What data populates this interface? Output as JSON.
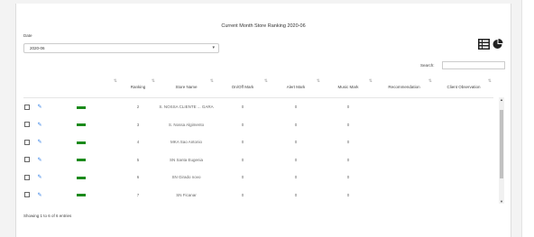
{
  "title": "Current Month Store Ranking 2020-06",
  "period": {
    "label": "Date",
    "value": "2020-06"
  },
  "search": {
    "label": "Search:",
    "value": ""
  },
  "columns": [
    "",
    "",
    "Ranking",
    "Store Name",
    "On/Off Mark",
    "Alert Mark",
    "Music Mark",
    "Recommendation",
    "Client Observation"
  ],
  "rows": [
    {
      "ranking": "2",
      "store": "S. NOSSA CLIENTE ... GARA",
      "onoff": "0",
      "alert": "0",
      "music": "0"
    },
    {
      "ranking": "3",
      "store": "S. Nossa Algimento",
      "onoff": "0",
      "alert": "0",
      "music": "0"
    },
    {
      "ranking": "4",
      "store": "MKA Sao Antonio",
      "onoff": "0",
      "alert": "0",
      "music": "0"
    },
    {
      "ranking": "5",
      "store": "SN Santa Eugenia",
      "onoff": "0",
      "alert": "0",
      "music": "0"
    },
    {
      "ranking": "6",
      "store": "SN Girado novo",
      "onoff": "0",
      "alert": "0",
      "music": "0"
    },
    {
      "ranking": "7",
      "store": "SN Ficanar",
      "onoff": "0",
      "alert": "0",
      "music": "0"
    }
  ],
  "footer": "Showing 1 to 6 of 6 entries",
  "colors": {
    "status_green": "#1a8a1a",
    "edit_blue": "#2c7be5"
  }
}
